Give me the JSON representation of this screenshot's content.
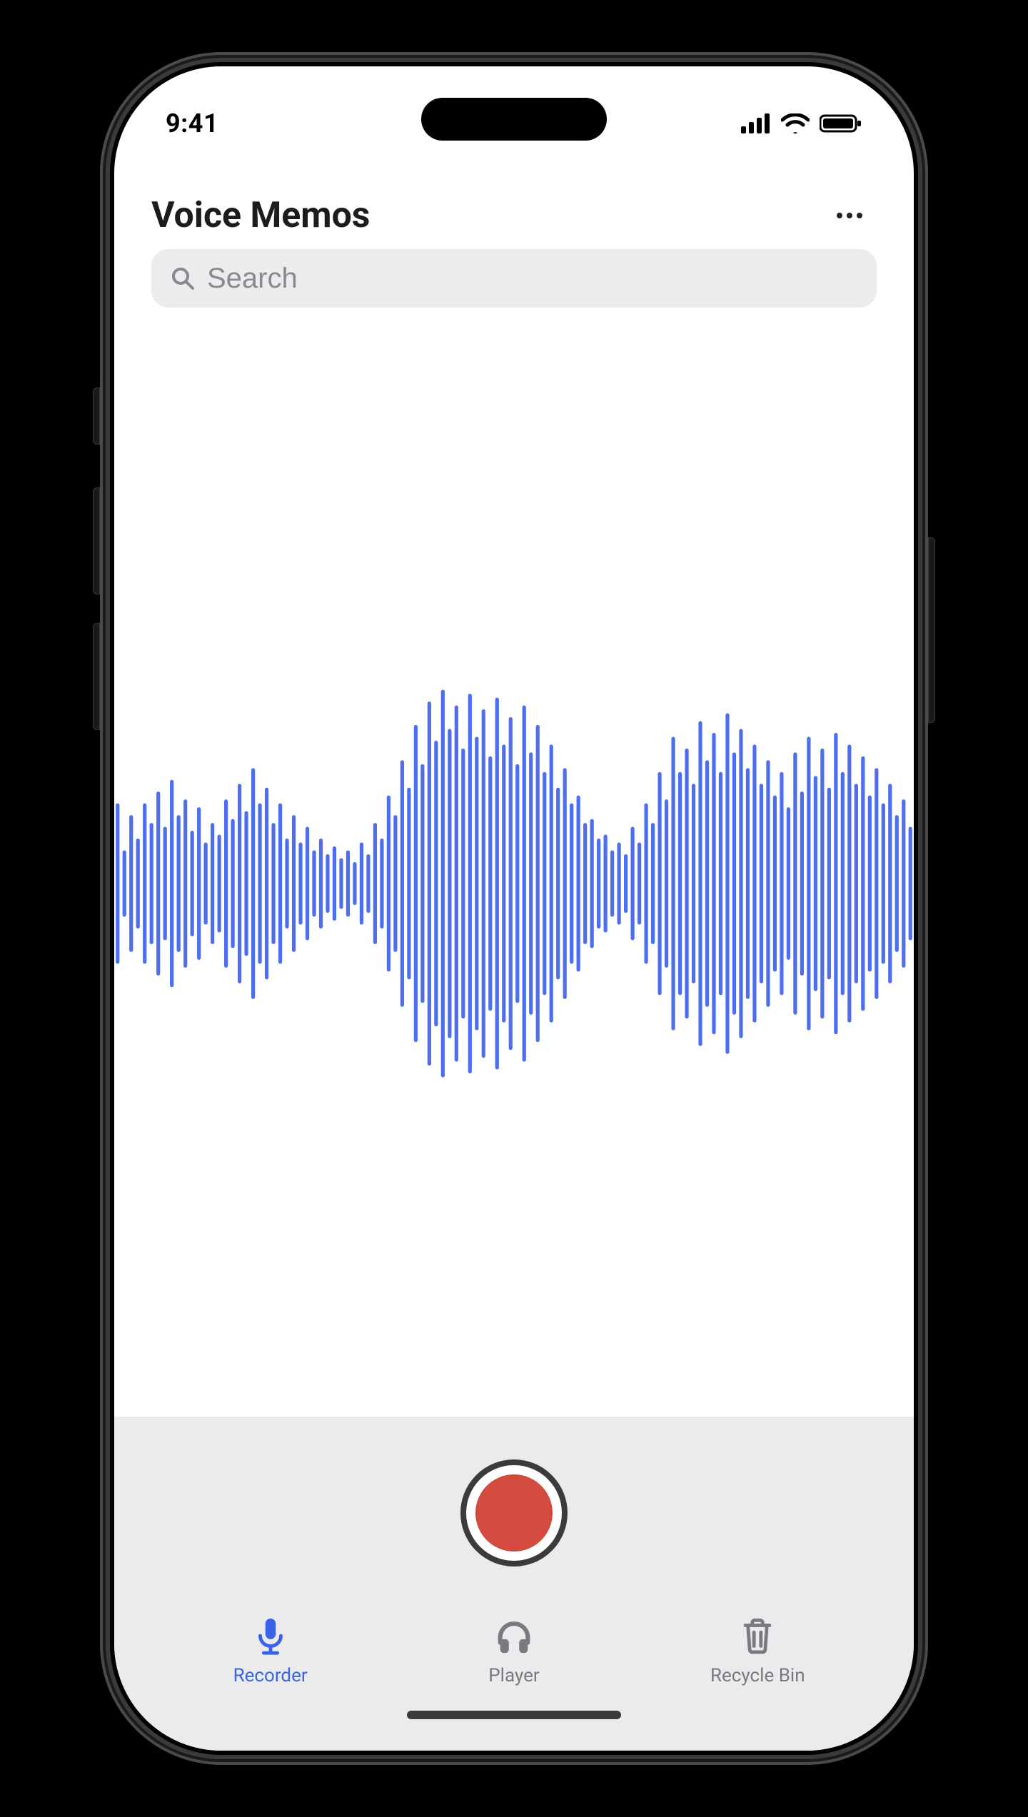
{
  "status": {
    "time": "9:41"
  },
  "header": {
    "title": "Voice Memos"
  },
  "search": {
    "placeholder": "Search"
  },
  "tabs": {
    "recorder": "Recorder",
    "player": "Player",
    "recycle": "Recycle Bin",
    "active": "recorder"
  },
  "colors": {
    "accent": "#3b63e6",
    "record": "#d24b3e",
    "wave": "#4e6ef0"
  },
  "chart_data": {
    "type": "bar",
    "title": "Audio waveform amplitude",
    "xlabel": "",
    "ylabel": "",
    "ylim": [
      -1,
      1
    ],
    "categories": [],
    "values": [
      0.4,
      0.16,
      0.34,
      0.22,
      0.4,
      0.3,
      0.46,
      0.28,
      0.52,
      0.34,
      0.42,
      0.26,
      0.38,
      0.2,
      0.3,
      0.24,
      0.42,
      0.32,
      0.5,
      0.36,
      0.58,
      0.4,
      0.48,
      0.3,
      0.4,
      0.22,
      0.34,
      0.2,
      0.28,
      0.16,
      0.22,
      0.14,
      0.18,
      0.12,
      0.16,
      0.1,
      0.2,
      0.14,
      0.3,
      0.22,
      0.44,
      0.34,
      0.62,
      0.48,
      0.8,
      0.6,
      0.92,
      0.72,
      0.98,
      0.78,
      0.9,
      0.68,
      0.96,
      0.74,
      0.88,
      0.64,
      0.94,
      0.7,
      0.84,
      0.6,
      0.9,
      0.66,
      0.8,
      0.56,
      0.7,
      0.48,
      0.58,
      0.4,
      0.44,
      0.3,
      0.32,
      0.22,
      0.24,
      0.16,
      0.2,
      0.14,
      0.28,
      0.2,
      0.4,
      0.3,
      0.56,
      0.42,
      0.74,
      0.56,
      0.68,
      0.5,
      0.82,
      0.62,
      0.76,
      0.56,
      0.86,
      0.66,
      0.78,
      0.58,
      0.7,
      0.5,
      0.62,
      0.44,
      0.56,
      0.38,
      0.66,
      0.46,
      0.74,
      0.54,
      0.68,
      0.48,
      0.76,
      0.56,
      0.7,
      0.5,
      0.64,
      0.44,
      0.58,
      0.4,
      0.5,
      0.34,
      0.42,
      0.28
    ]
  }
}
